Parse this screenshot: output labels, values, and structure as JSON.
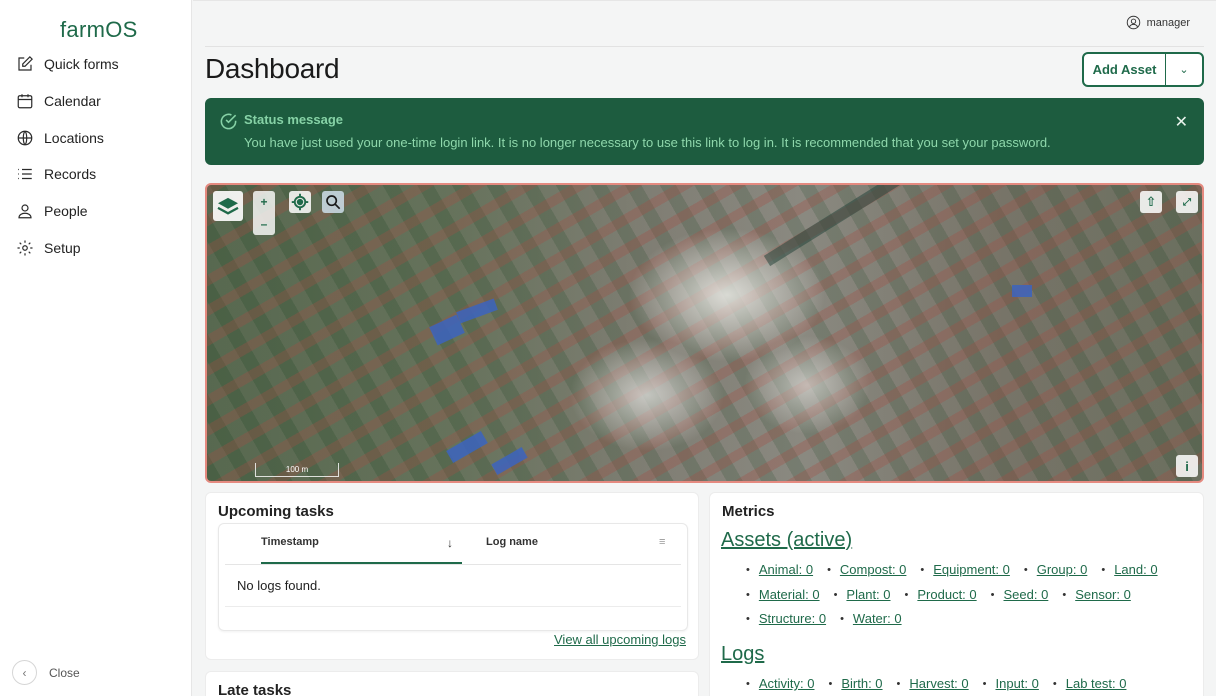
{
  "app": {
    "logo": "farmOS"
  },
  "sidebar": {
    "items": [
      {
        "label": "Quick forms",
        "icon": "edit-icon"
      },
      {
        "label": "Calendar",
        "icon": "calendar-icon"
      },
      {
        "label": "Locations",
        "icon": "globe-icon"
      },
      {
        "label": "Records",
        "icon": "list-icon"
      },
      {
        "label": "People",
        "icon": "person-icon"
      },
      {
        "label": "Setup",
        "icon": "gear-icon"
      }
    ],
    "close_label": "Close"
  },
  "header": {
    "user": "manager",
    "title": "Dashboard",
    "add_asset": "Add Asset"
  },
  "status": {
    "title": "Status message",
    "text": "You have just used your one-time login link. It is no longer necessary to use this link to log in. It is recommended that you set your password."
  },
  "map": {
    "zoom_in": "+",
    "zoom_out": "–",
    "scale": "100 m",
    "info": "i"
  },
  "upcoming": {
    "title": "Upcoming tasks",
    "col_timestamp": "Timestamp",
    "col_logname": "Log name",
    "empty": "No logs found.",
    "view_all": "View all upcoming logs"
  },
  "late": {
    "title": "Late tasks"
  },
  "metrics": {
    "title": "Metrics",
    "assets_heading": "Assets (active)",
    "assets": [
      [
        "Animal: 0",
        "Compost: 0",
        "Equipment: 0",
        "Group: 0",
        "Land: 0"
      ],
      [
        "Material: 0",
        "Plant: 0",
        "Product: 0",
        "Seed: 0",
        "Sensor: 0"
      ],
      [
        "Structure: 0",
        "Water: 0"
      ]
    ],
    "logs_heading": "Logs",
    "logs": [
      [
        "Activity: 0",
        "Birth: 0",
        "Harvest: 0",
        "Input: 0",
        "Lab test: 0"
      ]
    ]
  },
  "colors": {
    "brand": "#1f6a4a",
    "status_bg": "#1d5c3f",
    "status_text": "#86d2a6",
    "map_border": "#e58a80"
  }
}
